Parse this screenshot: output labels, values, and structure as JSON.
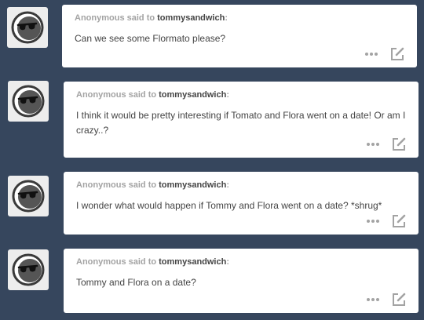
{
  "posts": [
    {
      "asker": "Anonymous",
      "said_to": "said to",
      "blog": "tommysandwich",
      "colon": ":",
      "question": "Can we see some Flormato please?"
    },
    {
      "asker": "Anonymous",
      "said_to": "said to",
      "blog": "tommysandwich",
      "colon": ":",
      "question": "I think it would be pretty interesting if Tomato and Flora went on a date! Or am I crazy..?"
    },
    {
      "asker": "Anonymous",
      "said_to": "said to",
      "blog": "tommysandwich",
      "colon": ":",
      "question": "I wonder what would happen if Tommy and Flora went on a date? *shrug*"
    },
    {
      "asker": "Anonymous",
      "said_to": "said to",
      "blog": "tommysandwich",
      "colon": ":",
      "question": "Tommy and Flora on a date?"
    }
  ],
  "icons": {
    "avatar": "anonymous-sunglasses-avatar",
    "more": "more-dots-icon",
    "edit": "edit-pencil-icon"
  },
  "colors": {
    "background": "#36465d",
    "card": "#ffffff",
    "asker_text": "#a3a3a3",
    "body_text": "#444444",
    "icon": "#a3a3a3"
  }
}
